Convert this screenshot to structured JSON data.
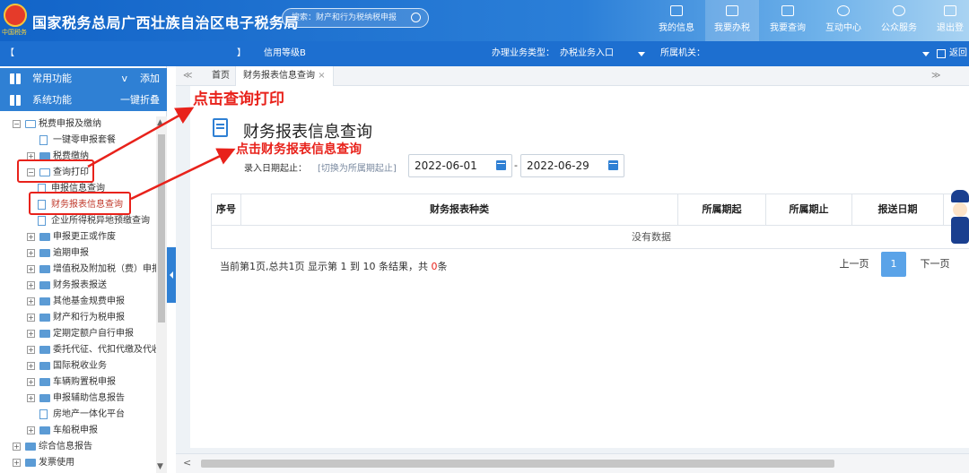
{
  "header": {
    "emblem_text": "中国税务",
    "title": "国家税务总局广西壮族自治区电子税务局",
    "search_placeholder": "搜索：财产和行为税纳税申报",
    "nav": [
      {
        "label": "我的信息",
        "icon": "user-icon"
      },
      {
        "label": "我要办税",
        "icon": "monitor-icon"
      },
      {
        "label": "我要查询",
        "icon": "query-icon"
      },
      {
        "label": "互动中心",
        "icon": "chat-icon"
      },
      {
        "label": "公众服务",
        "icon": "service-icon"
      },
      {
        "label": "退出登",
        "icon": "logout-icon"
      }
    ]
  },
  "infobar": {
    "taxpayer_bracket_open": "【",
    "taxpayer_bracket_close": "】",
    "credit_level": "信用等级B",
    "business_type_label": "办理业务类型：",
    "business_type_value": "办税业务入口",
    "authority_label": "所属机关：",
    "return_label": "返回"
  },
  "sidebar": {
    "common": {
      "label": "常用功能",
      "action": "添加",
      "chevron": "v"
    },
    "system": {
      "label": "系统功能",
      "action": "一键折叠"
    },
    "tree": [
      {
        "label": "税费申报及缴纳",
        "pm": "−",
        "icon": "folder-open"
      },
      {
        "label": "一键零申报套餐",
        "icon": "doc"
      },
      {
        "label": "税费缴纳",
        "pm": "+",
        "icon": "folder"
      },
      {
        "label": "查询打印",
        "pm": "−",
        "icon": "folder-open"
      },
      {
        "label": "申报信息查询",
        "icon": "doc"
      },
      {
        "label": "财务报表信息查询",
        "icon": "doc",
        "selected": true
      },
      {
        "label": "企业所得税异地预缴查询",
        "icon": "doc"
      },
      {
        "label": "申报更正或作废",
        "pm": "+",
        "icon": "folder"
      },
      {
        "label": "逾期申报",
        "pm": "+",
        "icon": "folder"
      },
      {
        "label": "增值税及附加税（费）申报",
        "pm": "+",
        "icon": "folder"
      },
      {
        "label": "财务报表报送",
        "pm": "+",
        "icon": "folder"
      },
      {
        "label": "其他基金规费申报",
        "pm": "+",
        "icon": "folder"
      },
      {
        "label": "财产和行为税申报",
        "pm": "+",
        "icon": "folder"
      },
      {
        "label": "定期定额户自行申报",
        "pm": "+",
        "icon": "folder"
      },
      {
        "label": "委托代征、代扣代缴及代收",
        "pm": "+",
        "icon": "folder"
      },
      {
        "label": "国际税收业务",
        "pm": "+",
        "icon": "folder"
      },
      {
        "label": "车辆购置税申报",
        "pm": "+",
        "icon": "folder"
      },
      {
        "label": "申报辅助信息报告",
        "pm": "+",
        "icon": "folder"
      },
      {
        "label": "房地产一体化平台",
        "icon": "doc"
      },
      {
        "label": "车船税申报",
        "pm": "+",
        "icon": "folder"
      },
      {
        "label": "综合信息报告",
        "pm": "+",
        "icon": "folder"
      },
      {
        "label": "发票使用",
        "pm": "+",
        "icon": "folder"
      }
    ]
  },
  "tabs": {
    "collapse": "≪",
    "home": "首页",
    "current": "财务报表信息查询",
    "close": "×",
    "expand": "≫"
  },
  "main": {
    "title": "财务报表信息查询",
    "date_label": "录入日期起止：",
    "date_hint": "[切换为所属期起止]",
    "date_start": "2022-06-01",
    "date_end": "2022-06-29",
    "date_sep": "-",
    "columns": [
      "序号",
      "财务报表种类",
      "所属期起",
      "所属期止",
      "报送日期"
    ],
    "empty_text": "没有数据",
    "pager_text_a": "当前第1页,总共1页    显示第 1 到 10 条结果，共 ",
    "pager_count": "0",
    "pager_text_b": "条",
    "prev": "上一页",
    "page": "1",
    "next": "下一页"
  },
  "annotations": {
    "query_print": "点击查询打印",
    "report_query": "点击财务报表信息查询",
    "color": "#e8221b"
  },
  "colors": {
    "header_blue": "#1264c8",
    "accent": "#2f80d4",
    "pager_active": "#5aa3e8"
  }
}
